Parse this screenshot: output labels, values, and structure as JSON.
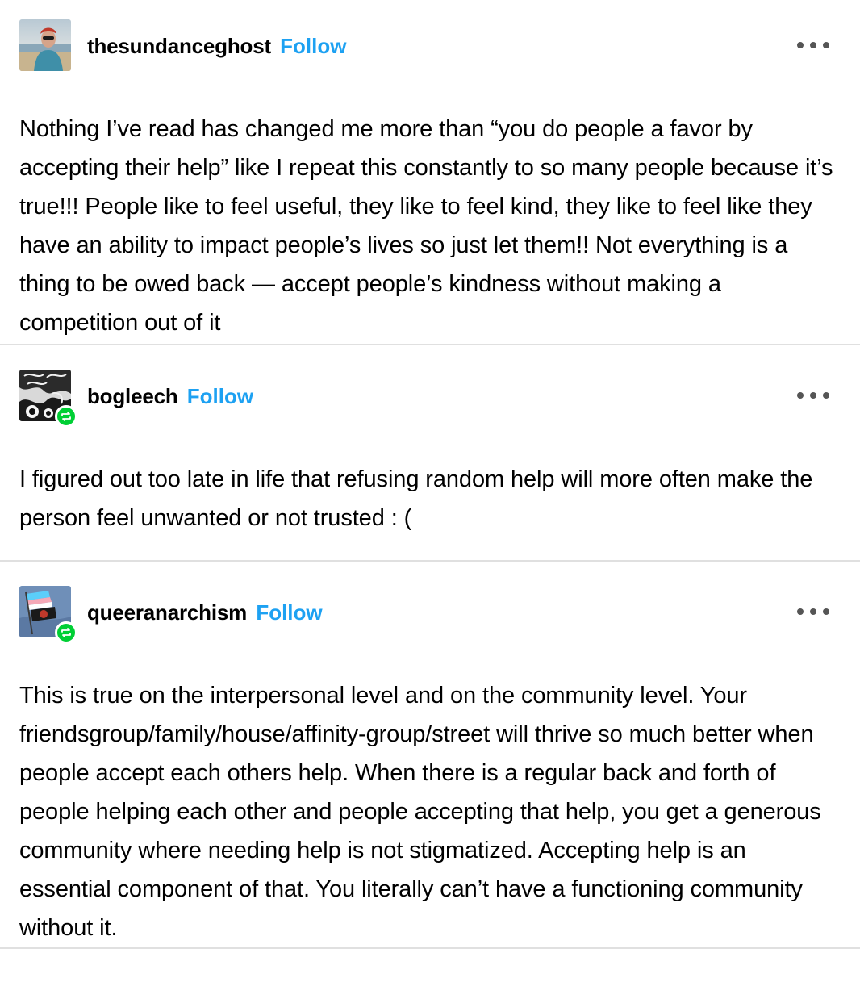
{
  "posts": [
    {
      "username": "thesundanceghost",
      "follow_label": "Follow",
      "avatar": "avatar-beach-photo",
      "reblogged": false,
      "text": "Nothing I’ve read has changed me more than “you do people a favor by accepting their help” like I repeat this constantly to so many people because it’s true!!! People like to feel useful, they like to feel kind, they like to feel like they have an ability to impact people’s lives so just let them!!  Not everything is a thing to be owed back — accept people’s kindness without making a competition out of it"
    },
    {
      "username": "bogleech",
      "follow_label": "Follow",
      "avatar": "avatar-monster-drawing",
      "reblogged": true,
      "text": "I figured out too late in life that refusing random help will more often make the person feel unwanted or not trusted : ("
    },
    {
      "username": "queeranarchism",
      "follow_label": "Follow",
      "avatar": "avatar-flag-photo",
      "reblogged": true,
      "text": "This is true on the interpersonal level and on the community level. Your friendsgroup/family/house/affinity-group/street will thrive so much better when people accept each others help. When there is a regular back and forth of people helping each other and people accepting that help, you get a generous community where needing help is not stigmatized. Accepting help is an essential component of that. You literally can’t have a functioning community without it."
    }
  ],
  "colors": {
    "follow": "#1da1f2",
    "reblog_badge": "#00cf35",
    "divider": "#e0e0e0"
  },
  "icons": {
    "more": "more-options-icon",
    "reblog": "reblog-icon"
  }
}
